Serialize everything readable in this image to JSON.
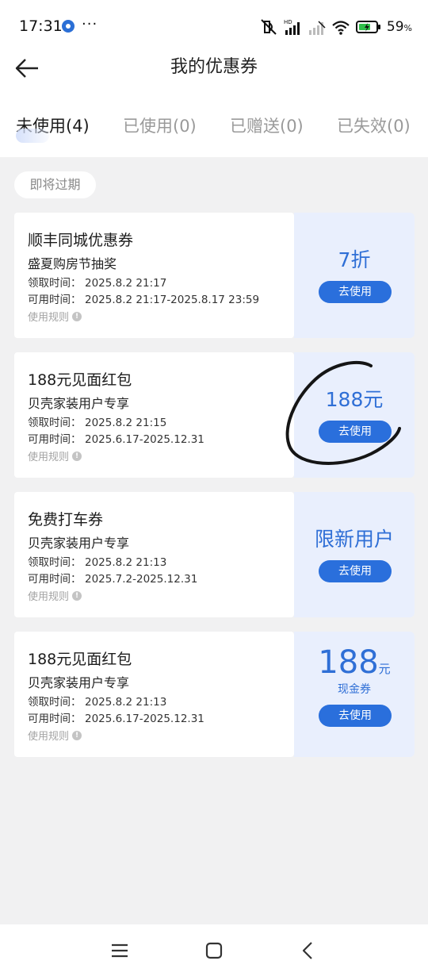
{
  "status_bar": {
    "time": "17:31",
    "dots": "···",
    "battery_percent": "59",
    "battery_unit": "%",
    "icons": [
      "app-notification-icon",
      "mute-icon",
      "hd-signal-icon",
      "signal-icon",
      "wifi-icon",
      "battery-icon"
    ]
  },
  "header": {
    "title": "我的优惠券",
    "back_icon": "back-arrow-icon"
  },
  "tabs": [
    {
      "label": "未使用(4)",
      "active": true
    },
    {
      "label": "已使用(0)",
      "active": false
    },
    {
      "label": "已赠送(0)",
      "active": false
    },
    {
      "label": "已失效(0)",
      "active": false
    }
  ],
  "section_label": "即将过期",
  "coupons": [
    {
      "title": "顺丰同城优惠券",
      "subtitle": "盛夏购房节抽奖",
      "receive_label": "领取时间：",
      "receive_time": "2025.8.2 21:17",
      "valid_label": "可用时间：",
      "valid_time": "2025.8.2 21:17-2025.8.17 23:59",
      "rule_label": "使用规则",
      "value": "7折",
      "button_label": "去使用"
    },
    {
      "title": "188元见面红包",
      "subtitle": "贝壳家装用户专享",
      "receive_label": "领取时间：",
      "receive_time": "2025.8.2 21:15",
      "valid_label": "可用时间：",
      "valid_time": "2025.6.17-2025.12.31",
      "rule_label": "使用规则",
      "value": "188元",
      "button_label": "去使用"
    },
    {
      "title": "免费打车券",
      "subtitle": "贝壳家装用户专享",
      "receive_label": "领取时间：",
      "receive_time": "2025.8.2 21:13",
      "valid_label": "可用时间：",
      "valid_time": "2025.7.2-2025.12.31",
      "rule_label": "使用规则",
      "value": "限新用户",
      "button_label": "去使用"
    },
    {
      "title": "188元见面红包",
      "subtitle": "贝壳家装用户专享",
      "receive_label": "领取时间：",
      "receive_time": "2025.8.2 21:13",
      "valid_label": "可用时间：",
      "valid_time": "2025.6.17-2025.12.31",
      "rule_label": "使用规则",
      "value_amount": "188",
      "value_unit": "元",
      "value_type": "现金券",
      "button_label": "去使用"
    }
  ],
  "bottom_nav": [
    "menu-icon",
    "home-icon",
    "back-icon"
  ],
  "colors": {
    "accent": "#2a6fdc",
    "coupon_right_bg": "#e9effd",
    "page_bg": "#f1f1f2"
  }
}
